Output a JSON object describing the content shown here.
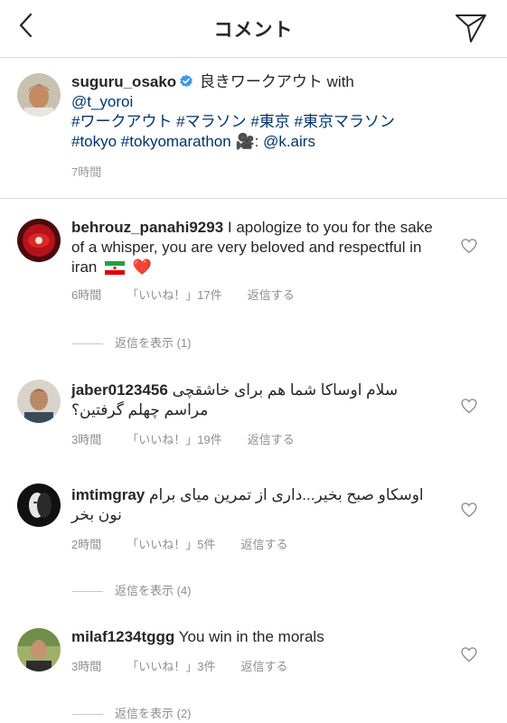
{
  "header": {
    "title": "コメント"
  },
  "caption": {
    "username": "suguru_osako",
    "text_1": " 良きワークアウト with ",
    "mention_1": "@t_yoroi",
    "hashtags": "#ワークアウト #マラソン #東京 #東京マラソン",
    "hashtags_2": "#tokyo #tokyomarathon",
    "video_icon": "🎥",
    "credit_sep": ": ",
    "mention_2": "@k.airs",
    "time": "7時間"
  },
  "comments": [
    {
      "username": "behrouz_panahi9293",
      "text": " I apologize to you for the sake of a whisper, you are very beloved and respectful in iran",
      "emoji": "❤️",
      "time": "6時間",
      "likes": "「いいね！」17件",
      "reply": "返信する",
      "view_replies": "返信を表示 (1)"
    },
    {
      "username": "jaber0123456",
      "text": "سلام اوساکا شما هم برای خاشقچی مراسم چهلم گرفتین؟",
      "time": "3時間",
      "likes": "「いいね！」19件",
      "reply": "返信する"
    },
    {
      "username": "imtimgray",
      "text": "اوسکاو صبح بخیر...داری از تمرین میای برام نون بخر",
      "time": "2時間",
      "likes": "「いいね！」5件",
      "reply": "返信する",
      "view_replies": "返信を表示 (4)"
    },
    {
      "username": "milaf1234tggg",
      "text": " You win in the morals",
      "time": "3時間",
      "likes": "「いいね！」3件",
      "reply": "返信する",
      "view_replies": "返信を表示 (2)"
    }
  ],
  "colors": {
    "link": "#003569",
    "verified": "#3897f0",
    "meta": "#8e8e8e",
    "divider": "#dbdbdb",
    "heart_red": "#ed4956"
  },
  "icons": {
    "back": "chevron-left-icon",
    "share": "paper-plane-icon",
    "like": "heart-outline-icon",
    "verified": "verified-badge-icon"
  }
}
